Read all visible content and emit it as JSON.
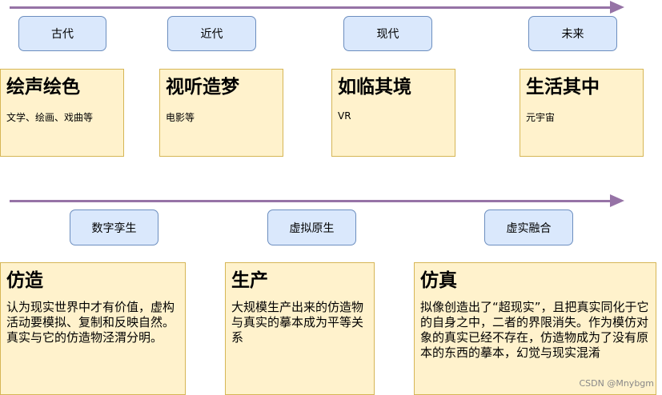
{
  "top": {
    "eras": [
      "古代",
      "近代",
      "现代",
      "未来"
    ],
    "cards": [
      {
        "title": "绘声绘色",
        "sub": "文学、绘画、戏曲等"
      },
      {
        "title": "视听造梦",
        "sub": "电影等"
      },
      {
        "title": "如临其境",
        "sub": "VR"
      },
      {
        "title": "生活其中",
        "sub": "元宇宙"
      }
    ]
  },
  "bottom": {
    "stages": [
      "数字孪生",
      "虚拟原生",
      "虚实融合"
    ],
    "cards": [
      {
        "title": "仿造",
        "body": "认为现实世界中才有价值，虚构活动要模拟、复制和反映自然。真实与它的仿造物泾渭分明。"
      },
      {
        "title": "生产",
        "body": "大规模生产出来的仿造物与真实的摹本成为平等关系"
      },
      {
        "title": "仿真",
        "body": "拟像创造出了“超现实”，且把真实同化于它的自身之中，二者的界限消失。作为模仿对象的真实已经不存在，仿造物成为了没有原本的东西的摹本，幻觉与现实混淆"
      }
    ]
  },
  "watermark": "CSDN @Mnybgm",
  "colors": {
    "arrow": "#9673a6",
    "era_fill": "#dae8fc",
    "era_border": "#6c8ebf",
    "card_fill": "#fff2cc",
    "card_border": "#d6b656"
  }
}
